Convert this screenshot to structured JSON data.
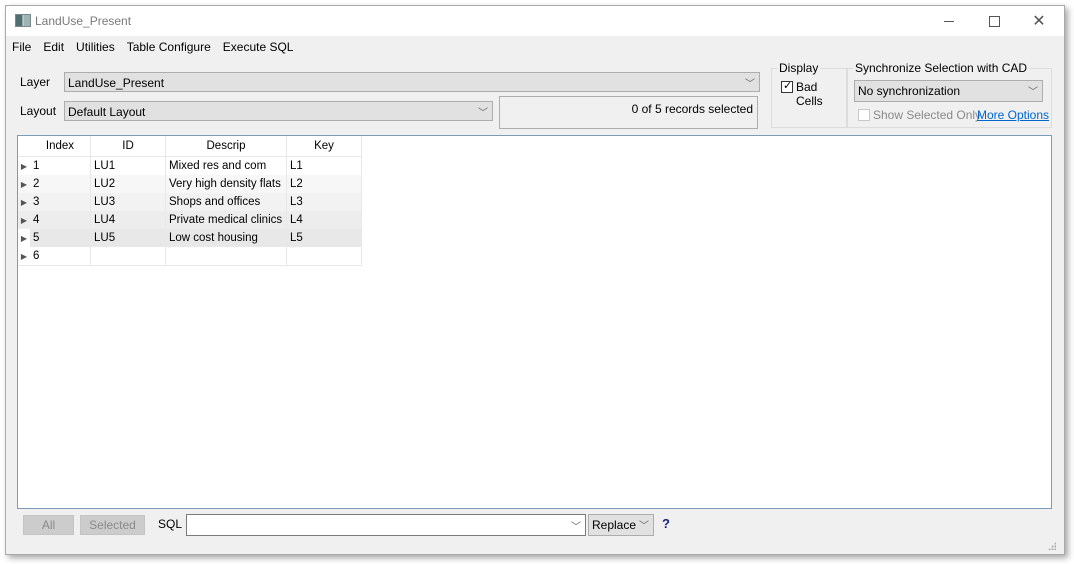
{
  "window": {
    "title": "LandUse_Present"
  },
  "menu": [
    "File",
    "Edit",
    "Utilities",
    "Table Configure",
    "Execute SQL"
  ],
  "layer": {
    "label": "Layer",
    "value": "LandUse_Present"
  },
  "layout": {
    "label": "Layout",
    "value": "Default Layout"
  },
  "status": "0 of 5 records selected",
  "display": {
    "title": "Display",
    "bad_cells_label": "Bad Cells",
    "bad_cells_checked": true
  },
  "sync": {
    "title": "Synchronize Selection with CAD",
    "value": "No synchronization",
    "show_selected_only": "Show Selected Only",
    "show_selected_checked": false,
    "more_options": "More Options"
  },
  "table": {
    "columns": [
      "Index",
      "ID",
      "Descrip",
      "Key"
    ],
    "rows": [
      [
        "1",
        "LU1",
        "Mixed res and com",
        "L1"
      ],
      [
        "2",
        "LU2",
        "Very high density flats",
        "L2"
      ],
      [
        "3",
        "LU3",
        "Shops and offices",
        "L3"
      ],
      [
        "4",
        "LU4",
        "Private medical clinics",
        "L4"
      ],
      [
        "5",
        "LU5",
        "Low cost housing",
        "L5"
      ],
      [
        "6",
        "",
        "",
        ""
      ]
    ]
  },
  "bottom": {
    "all": "All",
    "selected": "Selected",
    "sql_label": "SQL",
    "sql_value": "",
    "mode": "Replace",
    "help": "?"
  }
}
